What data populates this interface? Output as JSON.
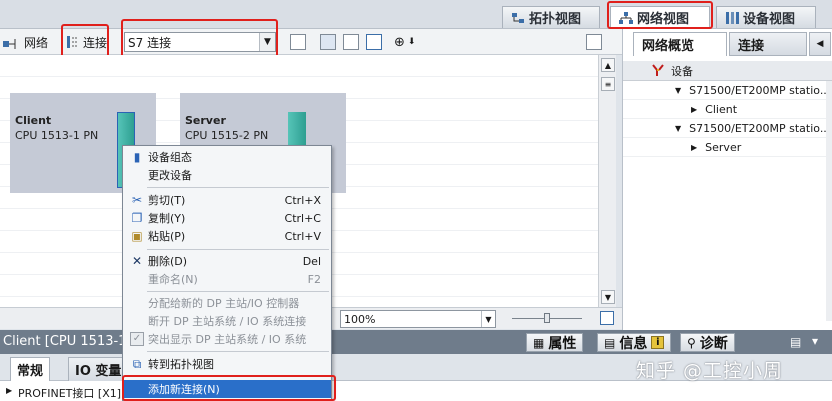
{
  "view_tabs": [
    {
      "label": "拓扑视图",
      "icon": "topology-icon"
    },
    {
      "label": "网络视图",
      "icon": "network-icon",
      "active": true
    },
    {
      "label": "设备视图",
      "icon": "device-icon"
    }
  ],
  "toolbar": {
    "network_label": "网络",
    "connections_label": "连接",
    "connection_type": "S7 连接"
  },
  "canvas": {
    "stations": [
      {
        "name": "Client",
        "cpu": "CPU 1513-1 PN"
      },
      {
        "name": "Server",
        "cpu": "CPU 1515-2 PN"
      }
    ],
    "zoom": "100%"
  },
  "overview": {
    "tabs": [
      "网络概览",
      "连接"
    ],
    "header": "设备",
    "rows": [
      {
        "label": "S71500/ET200MP statio...",
        "level": 0
      },
      {
        "label": "Client",
        "level": 1
      },
      {
        "label": "S71500/ET200MP statio...",
        "level": 0
      },
      {
        "label": "Server",
        "level": 1
      }
    ]
  },
  "context_menu": [
    {
      "label": "设备组态",
      "shortcut": "",
      "icon": "device-config-icon",
      "disabled": false
    },
    {
      "label": "更改设备",
      "shortcut": "",
      "icon": "",
      "disabled": false
    },
    {
      "label": "剪切(T)",
      "shortcut": "Ctrl+X",
      "icon": "scissors-icon",
      "disabled": false
    },
    {
      "label": "复制(Y)",
      "shortcut": "Ctrl+C",
      "icon": "copy-icon",
      "disabled": false
    },
    {
      "label": "粘贴(P)",
      "shortcut": "Ctrl+V",
      "icon": "paste-icon",
      "disabled": false
    },
    {
      "label": "删除(D)",
      "shortcut": "Del",
      "icon": "delete-icon",
      "disabled": false
    },
    {
      "label": "重命名(N)",
      "shortcut": "F2",
      "icon": "",
      "disabled": true
    },
    {
      "label": "分配给新的 DP 主站/IO 控制器",
      "shortcut": "",
      "icon": "",
      "disabled": true
    },
    {
      "label": "断开 DP 主站系统 / IO 系统连接",
      "shortcut": "",
      "icon": "",
      "disabled": true
    },
    {
      "label": "突出显示 DP 主站系统 / IO 系统",
      "shortcut": "",
      "icon": "checkbox-icon",
      "disabled": true
    },
    {
      "label": "转到拓扑视图",
      "shortcut": "",
      "icon": "topology-icon",
      "disabled": false
    },
    {
      "label": "添加新连接(N)",
      "shortcut": "",
      "icon": "",
      "disabled": false,
      "highlighted": true
    }
  ],
  "inspector": {
    "title": "Client [CPU 1513-1",
    "tabs": [
      "属性",
      "信息",
      "诊断"
    ],
    "subtabs": [
      "常规",
      "IO 变量"
    ],
    "property_line": "PROFINET接口 [X1]"
  },
  "watermark": "知乎 @工控小周",
  "colors": {
    "accent_red": "#e0201c",
    "highlight": "#2a6fc9",
    "module_teal": "#3fb3a5",
    "station_bg": "#c5cad6"
  }
}
